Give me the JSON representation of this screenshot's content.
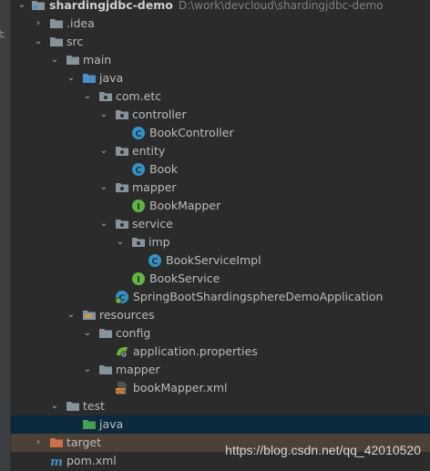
{
  "side_tab_label": "Pr",
  "colors": {
    "background": "#2b2b2b",
    "selected_row": "#0d293e",
    "excluded_row": "#4b4136",
    "folder": "#87939a",
    "source_folder": "#4a8fc7",
    "test_folder": "#499c54",
    "excluded_folder": "#d0704a",
    "class_icon": "#3592c4",
    "interface_icon": "#62b543"
  },
  "project": {
    "name": "shardingjdbc-demo",
    "path": "D:\\work\\devcloud\\shardingjdbc-demo"
  },
  "tree": [
    {
      "label": "shardingjdbc-demo",
      "icon": "module-folder-icon",
      "expanded": true
    },
    {
      "label": ".idea",
      "icon": "folder-icon",
      "expanded": false
    },
    {
      "label": "src",
      "icon": "folder-icon",
      "expanded": true
    },
    {
      "label": "main",
      "icon": "folder-icon",
      "expanded": true
    },
    {
      "label": "java",
      "icon": "source-folder-icon",
      "expanded": true
    },
    {
      "label": "com.etc",
      "icon": "package-icon",
      "expanded": true
    },
    {
      "label": "controller",
      "icon": "package-icon",
      "expanded": true
    },
    {
      "label": "BookController",
      "icon": "class-icon"
    },
    {
      "label": "entity",
      "icon": "package-icon",
      "expanded": true
    },
    {
      "label": "Book",
      "icon": "class-icon"
    },
    {
      "label": "mapper",
      "icon": "package-icon",
      "expanded": true
    },
    {
      "label": "BookMapper",
      "icon": "interface-icon"
    },
    {
      "label": "service",
      "icon": "package-icon",
      "expanded": true
    },
    {
      "label": "imp",
      "icon": "package-icon",
      "expanded": true
    },
    {
      "label": "BookServiceImpl",
      "icon": "class-icon"
    },
    {
      "label": "BookService",
      "icon": "interface-icon"
    },
    {
      "label": "SpringBootShardingsphereDemoApplication",
      "icon": "spring-boot-class-icon"
    },
    {
      "label": "resources",
      "icon": "resources-folder-icon",
      "expanded": true
    },
    {
      "label": "config",
      "icon": "folder-icon",
      "expanded": true
    },
    {
      "label": "application.properties",
      "icon": "spring-properties-icon"
    },
    {
      "label": "mapper",
      "icon": "folder-icon",
      "expanded": true
    },
    {
      "label": "bookMapper.xml",
      "icon": "xml-file-icon"
    },
    {
      "label": "test",
      "icon": "folder-icon",
      "expanded": true
    },
    {
      "label": "java",
      "icon": "test-source-folder-icon",
      "selected": true
    },
    {
      "label": "target",
      "icon": "excluded-folder-icon",
      "expanded": false
    },
    {
      "label": "pom.xml",
      "icon": "maven-file-icon"
    }
  ],
  "watermark": "https://blog.csdn.net/qq_42010520"
}
